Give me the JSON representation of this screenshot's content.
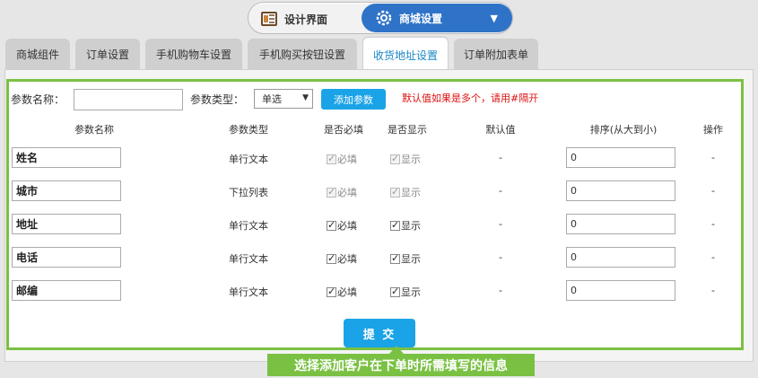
{
  "switch": {
    "left_label": "设计界面",
    "right_label": "商城设置"
  },
  "tabs": [
    {
      "label": "商城组件"
    },
    {
      "label": "订单设置"
    },
    {
      "label": "手机购物车设置"
    },
    {
      "label": "手机购买按钮设置"
    },
    {
      "label": "收货地址设置",
      "active": true
    },
    {
      "label": "订单附加表单"
    }
  ],
  "toolbar": {
    "name_label": "参数名称：",
    "name_value": "",
    "type_label": "参数类型：",
    "type_value": "单选",
    "add_button": "添加参数",
    "hint": "默认值如果是多个，请用#隔开"
  },
  "table": {
    "headers": [
      "参数名称",
      "参数类型",
      "是否必填",
      "是否显示",
      "默认值",
      "排序(从大到小)",
      "操作"
    ],
    "required_label": "必填",
    "show_label": "显示",
    "rows": [
      {
        "name": "姓名",
        "type": "单行文本",
        "default": "-",
        "sort": "0",
        "action": "-"
      },
      {
        "name": "城市",
        "type": "下拉列表",
        "default": "-",
        "sort": "0",
        "action": "-"
      },
      {
        "name": "地址",
        "type": "单行文本",
        "default": "-",
        "sort": "0",
        "action": "-"
      },
      {
        "name": "电话",
        "type": "单行文本",
        "default": "-",
        "sort": "0",
        "action": "-"
      },
      {
        "name": "邮编",
        "type": "单行文本",
        "default": "-",
        "sort": "0",
        "action": "-"
      }
    ]
  },
  "submit_label": "提 交",
  "caption": "选择添加客户在下单时所需填写的信息",
  "colors": {
    "accent_green": "#7ac143",
    "button_blue": "#1aa3e6",
    "switch_blue": "#2f73c8",
    "hint_red": "#dd1111"
  }
}
